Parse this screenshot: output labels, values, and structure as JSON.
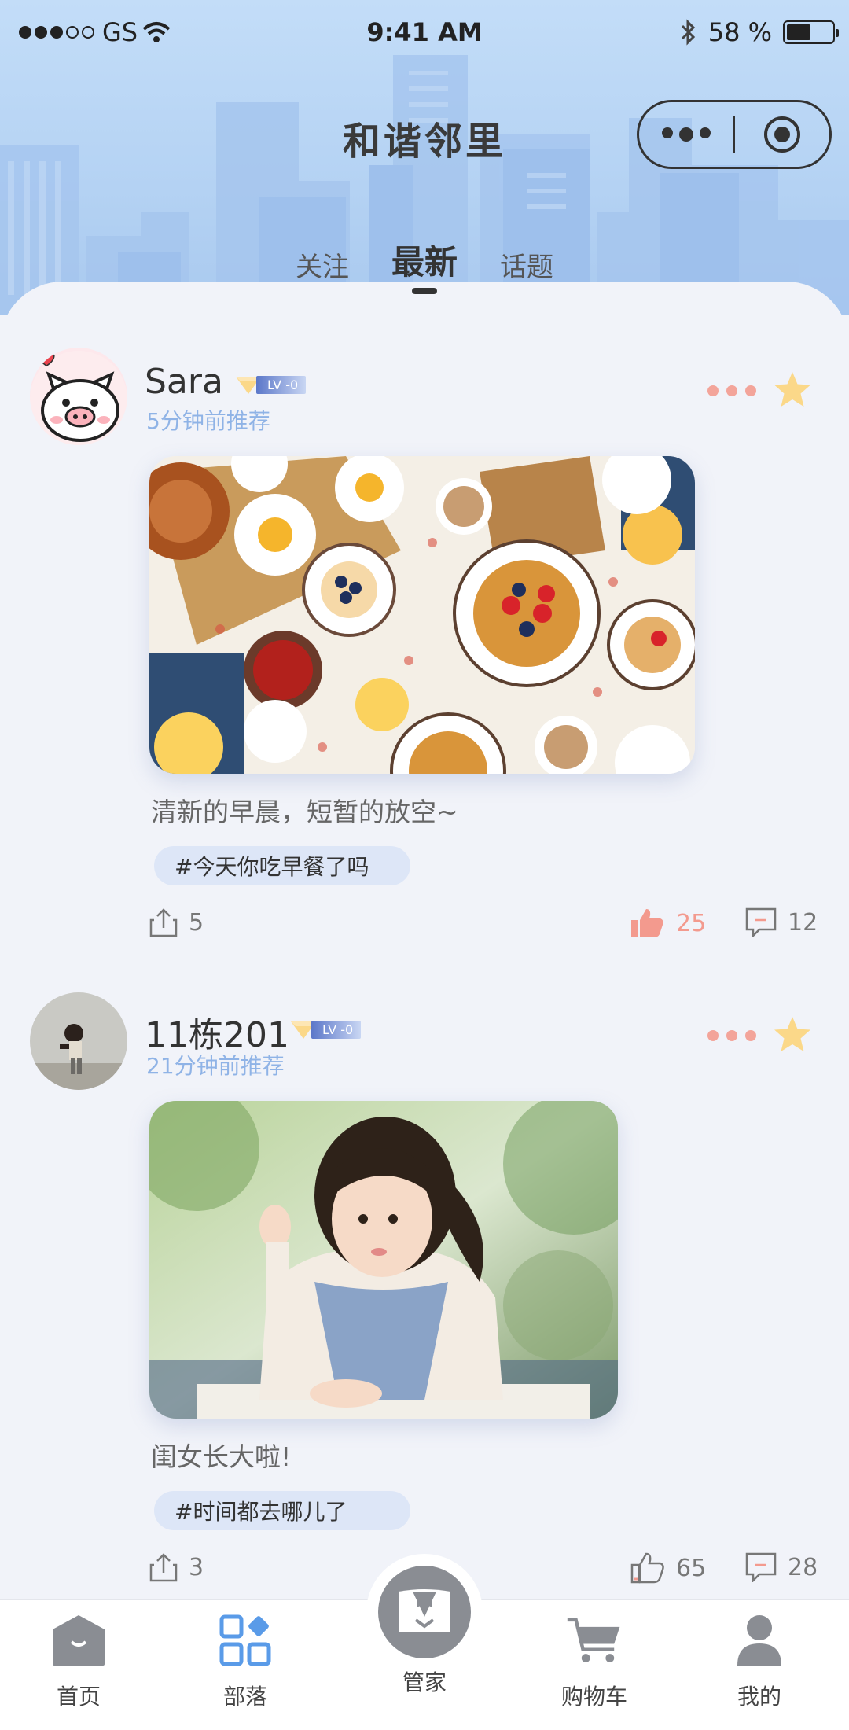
{
  "status_bar": {
    "carrier": "GS",
    "time": "9:41 AM",
    "battery": "58 %"
  },
  "app": {
    "title": "和谐邻里"
  },
  "tabs": [
    {
      "label": "关注",
      "active": false
    },
    {
      "label": "最新",
      "active": true
    },
    {
      "label": "话题",
      "active": false
    }
  ],
  "posts": [
    {
      "username": "Sara",
      "level": "LV -0",
      "time_ago": "5分钟前推荐",
      "caption": "清新的早晨，短暂的放空~",
      "hashtag": "#今天你吃早餐了吗",
      "shares": "5",
      "likes": "25",
      "comments": "12",
      "liked": true
    },
    {
      "username": "11栋201",
      "level": "LV -0",
      "time_ago": "21分钟前推荐",
      "caption": "闺女长大啦!",
      "hashtag": "#时间都去哪儿了",
      "shares": "3",
      "likes": "65",
      "comments": "28",
      "liked": false
    }
  ],
  "bottom_nav": [
    {
      "label": "首页",
      "icon": "home-icon"
    },
    {
      "label": "部落",
      "icon": "tribe-grid-icon",
      "active": true
    },
    {
      "label": "管家",
      "icon": "butler-icon"
    },
    {
      "label": "购物车",
      "icon": "cart-icon"
    },
    {
      "label": "我的",
      "icon": "profile-icon"
    }
  ],
  "colors": {
    "accent_blue": "#5a9be8",
    "like_red": "#f39a8e",
    "time_blue": "#8fb3e6",
    "star_yellow": "#fbd889"
  }
}
